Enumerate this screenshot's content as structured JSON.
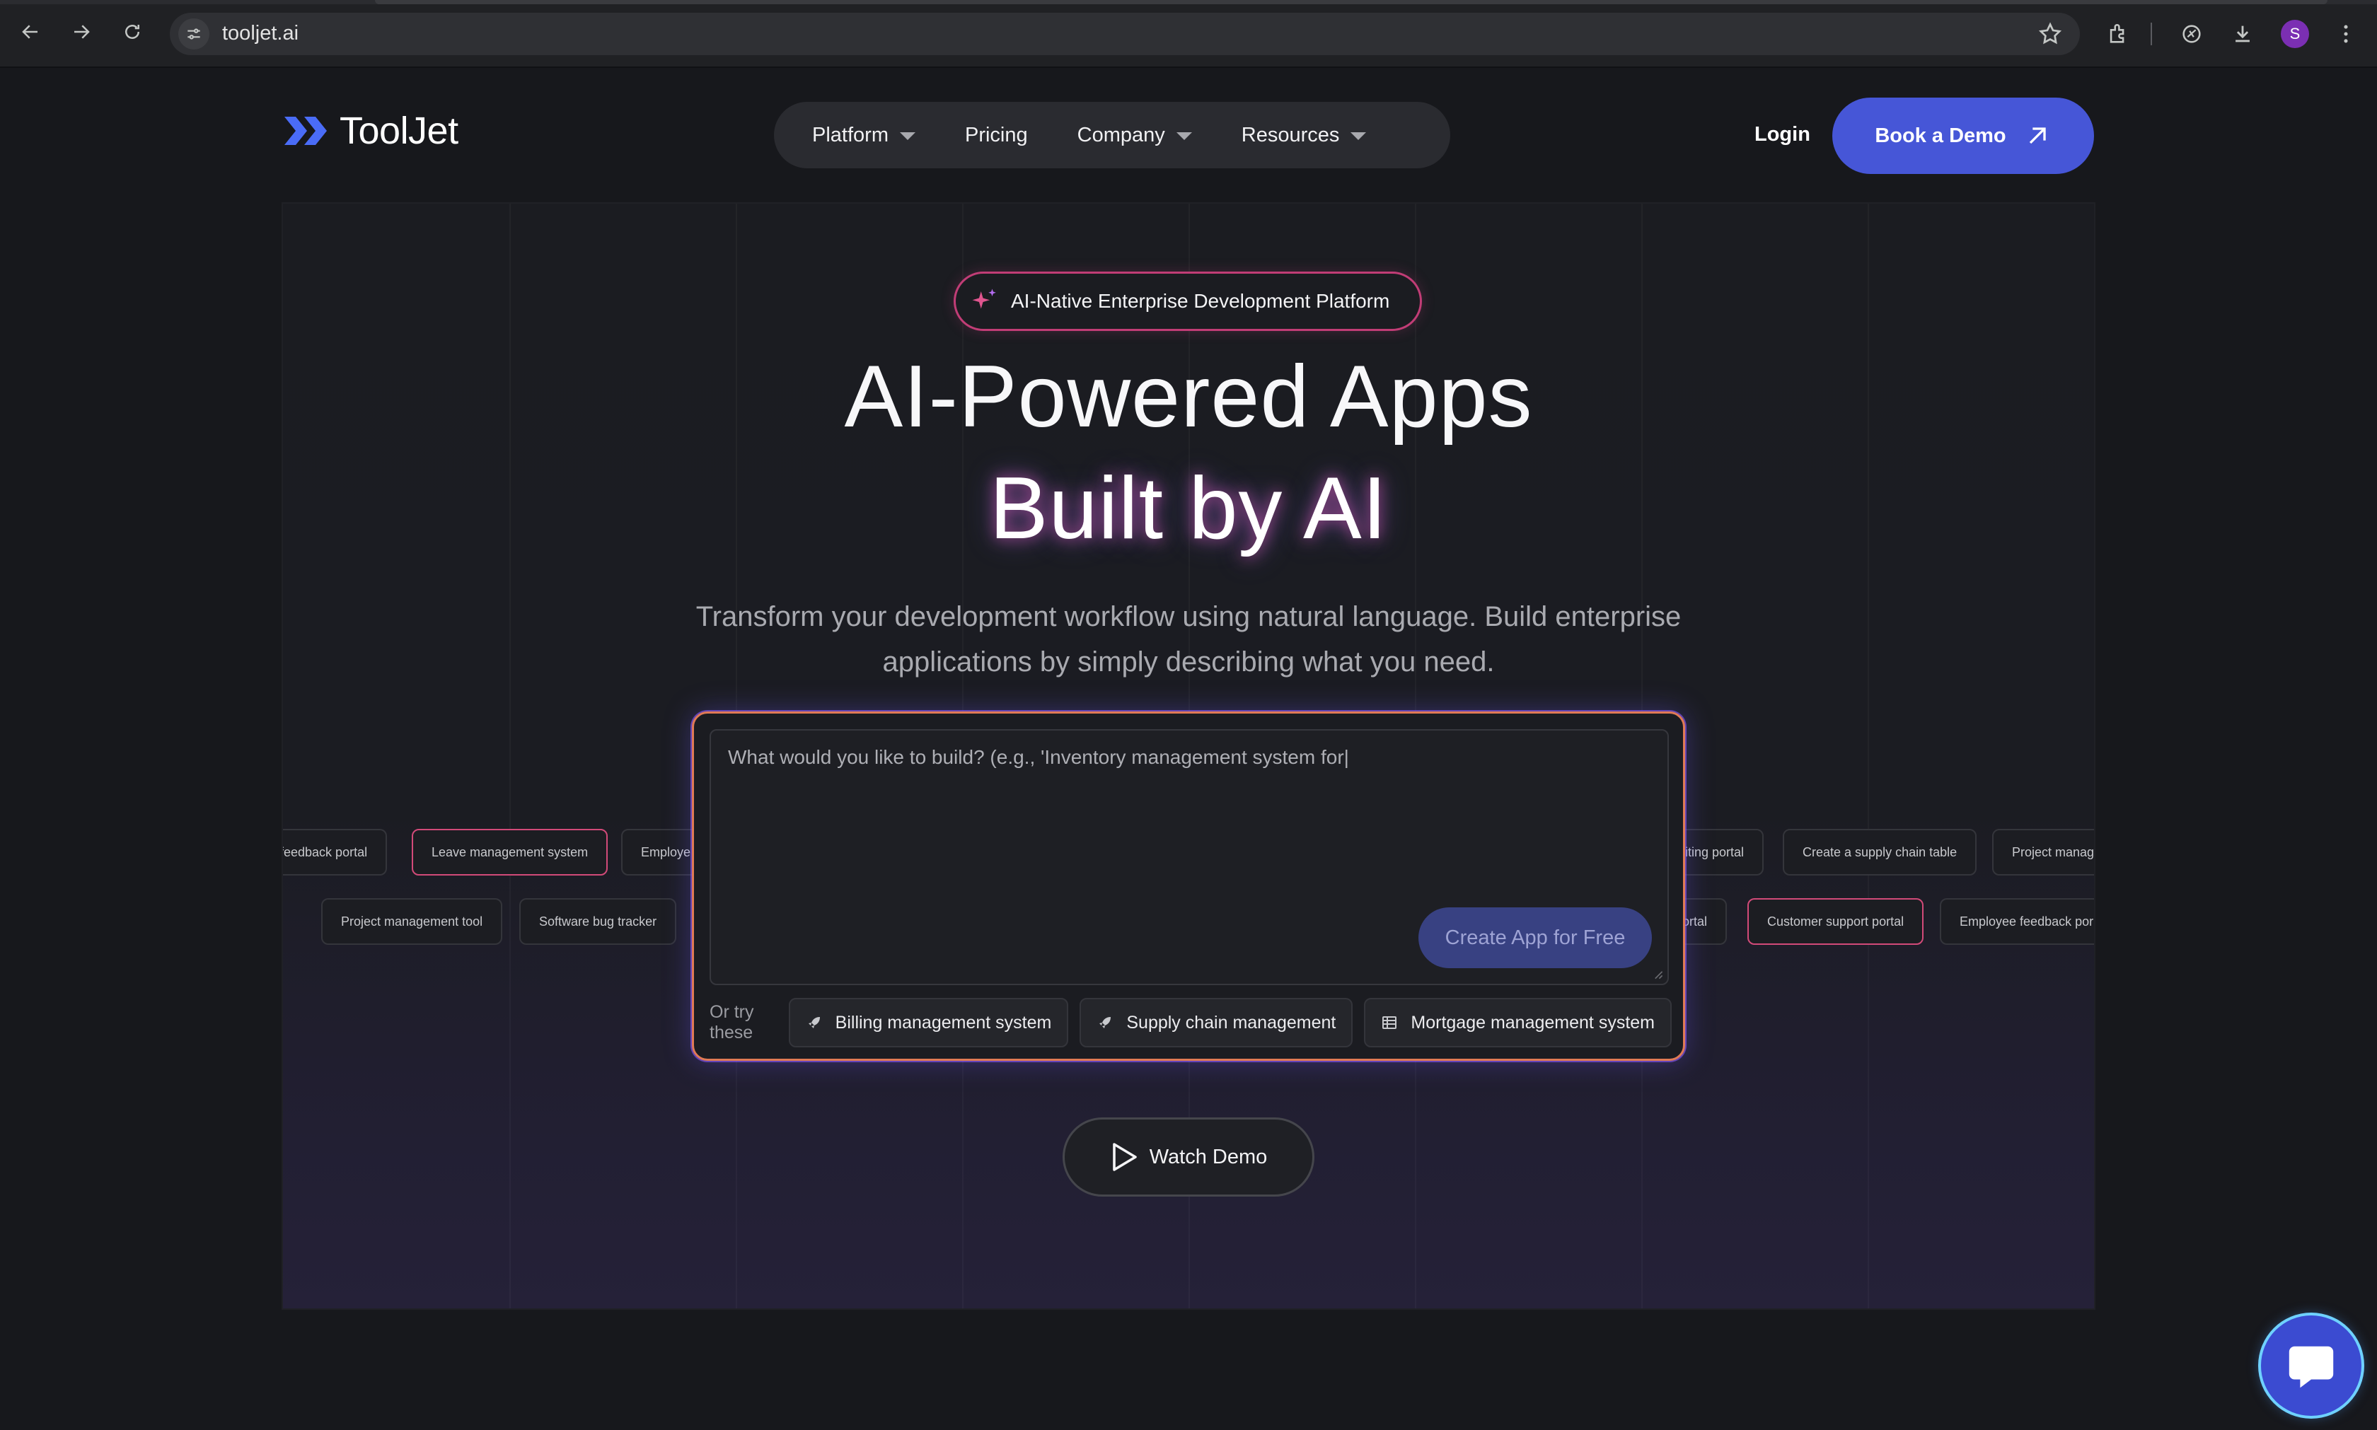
{
  "browser": {
    "url": "tooljet.ai",
    "profile_initial": "S"
  },
  "header": {
    "logo_text": "ToolJet",
    "nav": [
      {
        "label": "Platform",
        "has_dropdown": true
      },
      {
        "label": "Pricing",
        "has_dropdown": false
      },
      {
        "label": "Company",
        "has_dropdown": true
      },
      {
        "label": "Resources",
        "has_dropdown": true
      }
    ],
    "login_label": "Login",
    "demo_label": "Book a Demo"
  },
  "hero": {
    "badge": "AI-Native Enterprise Development Platform",
    "title_line1": "AI-Powered Apps",
    "title_line2": "Built by AI",
    "subtitle_line1": "Transform your development workflow using natural language. Build enterprise",
    "subtitle_line2": "applications by simply describing what you need.",
    "prompt_placeholder": "What would you like to build? (e.g., 'Inventory management system for|",
    "create_label": "Create App for Free",
    "try_label": "Or try these",
    "suggestions": [
      {
        "label": "Billing management system",
        "icon": "rocket-icon"
      },
      {
        "label": "Supply chain management",
        "icon": "rocket-icon"
      },
      {
        "label": "Mortgage management system",
        "icon": "table-icon"
      }
    ],
    "watch_label": "Watch Demo"
  },
  "ticker": {
    "left_row1": [
      "feedback portal",
      "Leave management system",
      "Employe"
    ],
    "left_row2": [
      "Project management tool",
      "Software bug tracker"
    ],
    "right_row1": [
      "iting portal",
      "Create a supply chain table",
      "Project manage"
    ],
    "right_row2": [
      "ortal",
      "Customer support portal",
      "Employee feedback por"
    ]
  },
  "colors": {
    "accent": "#4656d7",
    "badge_border": "#c13d76",
    "prompt_border": "#e07a55",
    "background": "#17181c"
  }
}
